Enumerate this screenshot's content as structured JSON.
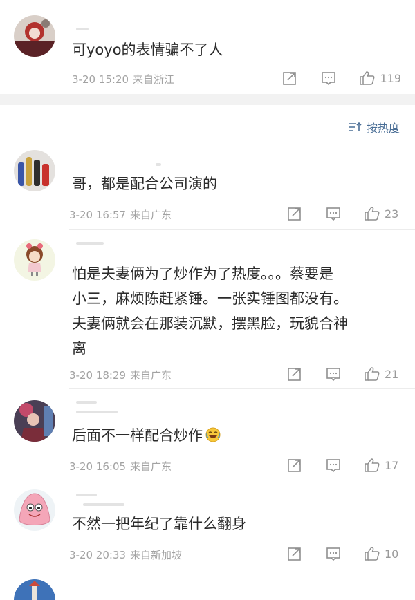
{
  "comments_top": [
    {
      "text": "可yoyo的表情骗不了人",
      "time": "3-20 15:20",
      "source": "来自浙江",
      "likes": "119"
    }
  ],
  "sort_label": "按热度",
  "comments": [
    {
      "text": "哥，都是配合公司演的",
      "time": "3-20 16:57",
      "source": "来自广东",
      "likes": "23"
    },
    {
      "lines": [
        "怕是夫妻俩为了炒作为了热度。。。蔡要是",
        "小三，麻烦陈赶紧锤。一张实锤图都没有。",
        "夫妻俩就会在那装沉默，摆黑脸，玩貌合神",
        "离"
      ],
      "time": "3-20 18:29",
      "source": "来自广东",
      "likes": "21"
    },
    {
      "text": "后面不一样配合炒作",
      "emoji": "laugh-cry-emoji",
      "time": "3-20 16:05",
      "source": "来自广东",
      "likes": "17"
    },
    {
      "text": "不然一把年纪了靠什么翻身",
      "time": "3-20 20:33",
      "source": "来自新加坡",
      "likes": "10"
    }
  ],
  "icons": {
    "share": "share-icon",
    "comment": "comment-icon",
    "like": "thumbs-up-icon",
    "sort": "sort-icon"
  },
  "colors": {
    "meta": "#a2a2a2",
    "link": "#4a6e96",
    "background": "#f2f2f2"
  }
}
